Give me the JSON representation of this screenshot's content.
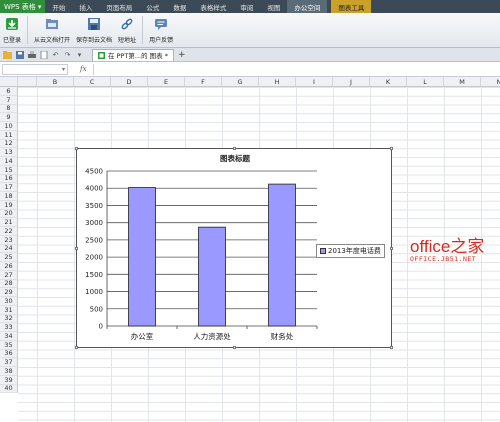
{
  "menu": {
    "app_label": "WPS 表格",
    "items": [
      "开始",
      "插入",
      "页面布局",
      "公式",
      "数据",
      "表格样式",
      "审阅",
      "视图",
      "办公空间"
    ],
    "active": "办公空间",
    "chart_tools": "图表工具"
  },
  "ribbon": {
    "login": "已登录",
    "open_cloud": "从云文档打开",
    "save_cloud": "保存到云文档",
    "short_addr": "短地址",
    "feedback": "用户反馈"
  },
  "tabs": {
    "doc_tab": "在 PPT第...的 图表 *",
    "add": "+"
  },
  "formula": {
    "fx": "fx"
  },
  "grid": {
    "columns": [
      "B",
      "C",
      "D",
      "E",
      "F",
      "G",
      "H",
      "I",
      "J",
      "K",
      "L",
      "M",
      "N"
    ],
    "rows": [
      "6",
      "7",
      "8",
      "9",
      "10",
      "11",
      "12",
      "13",
      "14",
      "15",
      "16",
      "17",
      "18",
      "19",
      "20",
      "21",
      "22",
      "23",
      "24",
      "25",
      "26",
      "27",
      "28",
      "29",
      "30",
      "31",
      "32",
      "33",
      "34",
      "35",
      "36",
      "37",
      "38",
      "39",
      "40"
    ]
  },
  "chart_data": {
    "type": "bar",
    "title": "图表标题",
    "categories": [
      "办公室",
      "人力资源处",
      "财务处"
    ],
    "series": [
      {
        "name": "2013年度电话费",
        "values": [
          4020,
          2870,
          4120
        ],
        "color": "#9999ff"
      }
    ],
    "ylim": [
      0,
      4500
    ],
    "yticks": [
      0,
      500,
      1000,
      1500,
      2000,
      2500,
      3000,
      3500,
      4000,
      4500
    ],
    "grid": true,
    "legend_position": "right"
  },
  "watermark": {
    "big": "office之家",
    "small": "OFFICE.JB51.NET"
  }
}
